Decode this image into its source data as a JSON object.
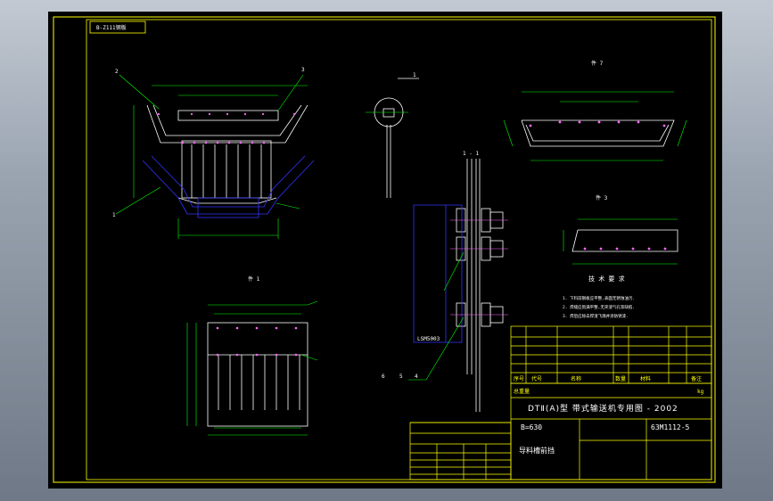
{
  "drawing": {
    "corner_tag": "B-Z111钢板",
    "section_label": "1 - 1",
    "view_labels": {
      "top_right": "件 7",
      "mid_right": "件 3",
      "bottom_left": "件 1"
    },
    "callouts": [
      "2",
      "3",
      "1",
      "1",
      "6",
      "5",
      "4"
    ],
    "bolt_note": "LSM5003",
    "tech_req": {
      "title": "技 术 要 求",
      "lines": [
        "1. 下料前钢板应平整,表面无锈蚀油污.",
        "2. 焊缝应饱满平整,无夹渣气孔等缺陷.",
        "3. 焊后应除去焊渣飞溅并涂防锈漆."
      ]
    },
    "title_block": {
      "project": "DTⅡ(A)型 带式输送机专用图 - 2002",
      "spec": "B=630",
      "drawing_no": "63M1112-5",
      "name": "导料槽前挡",
      "header_row": [
        "序号",
        "代号",
        "名称",
        "数量",
        "材料",
        "备注"
      ],
      "weight_label": "总重量",
      "weight_unit": "kg"
    },
    "colors": {
      "background": "#000000",
      "frame": "#ffff00",
      "geometry": "#ffffff",
      "dims": "#00ff00",
      "hidden": "#3333ff",
      "center": "#ff00ff"
    }
  }
}
